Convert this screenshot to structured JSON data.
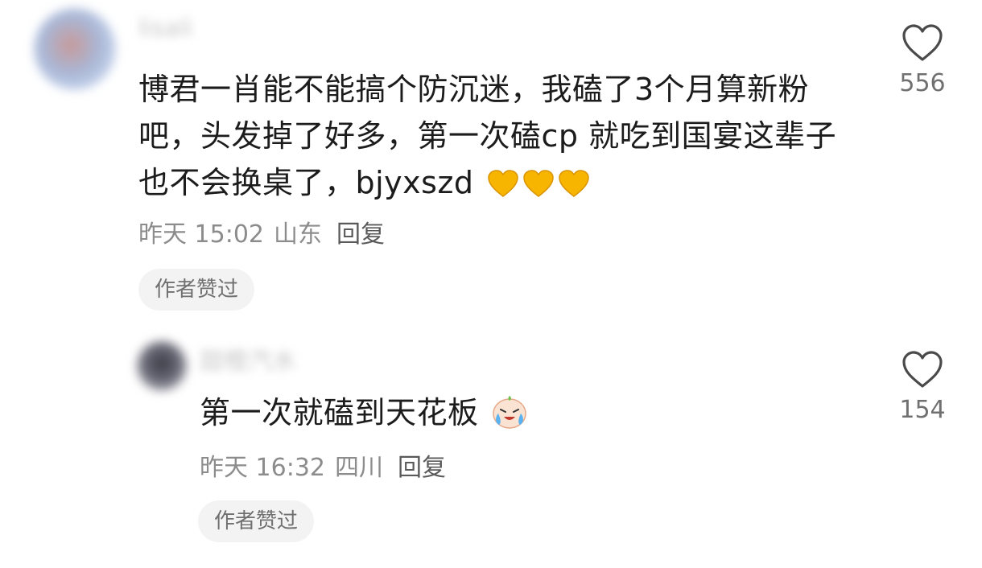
{
  "comments": [
    {
      "username": "lisali",
      "text": "博君一肖能不能搞个防沉迷，我磕了3个月算新粉吧，头发掉了好多，第一次磕cp 就吃到国宴这辈子也不会换桌了，bjyxszd",
      "emoji": "yellow-heart",
      "time": "昨天 15:02",
      "location": "山东",
      "reply": "回复",
      "badge": "作者赞过",
      "likes": "556"
    },
    {
      "username": "甜橙汽水",
      "text": "第一次就磕到天花板",
      "emoji": "crying-face",
      "time": "昨天 16:32",
      "location": "四川",
      "reply": "回复",
      "badge": "作者赞过",
      "likes": "154"
    }
  ]
}
